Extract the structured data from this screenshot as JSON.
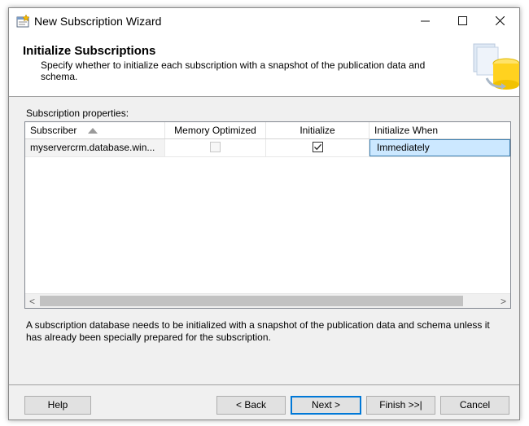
{
  "window": {
    "title": "New Subscription Wizard",
    "controls": {
      "minimize": "—",
      "maximize": "☐",
      "close": "✕"
    }
  },
  "header": {
    "title": "Initialize Subscriptions",
    "description": "Specify whether to initialize each subscription with a snapshot of the publication data and schema."
  },
  "grid": {
    "label": "Subscription properties:",
    "columns": [
      "Subscriber",
      "Memory Optimized",
      "Initialize",
      "Initialize When"
    ],
    "sort_column": "Subscriber",
    "rows": [
      {
        "subscriber": "myservercrm.database.win...",
        "memory_optimized": false,
        "memory_optimized_enabled": false,
        "initialize": true,
        "initialize_when": "Immediately"
      }
    ],
    "scroll_left": "<",
    "scroll_right": ">"
  },
  "info_text": "A subscription database needs to be initialized with a snapshot of the publication data and schema unless it has already been specially prepared for the subscription.",
  "buttons": {
    "help": "Help",
    "back": "< Back",
    "next": "Next >",
    "finish": "Finish >>|",
    "cancel": "Cancel"
  },
  "colors": {
    "selection_bg": "#cce8ff",
    "selection_border": "#3c7fb1",
    "default_button_border": "#0078d7"
  }
}
